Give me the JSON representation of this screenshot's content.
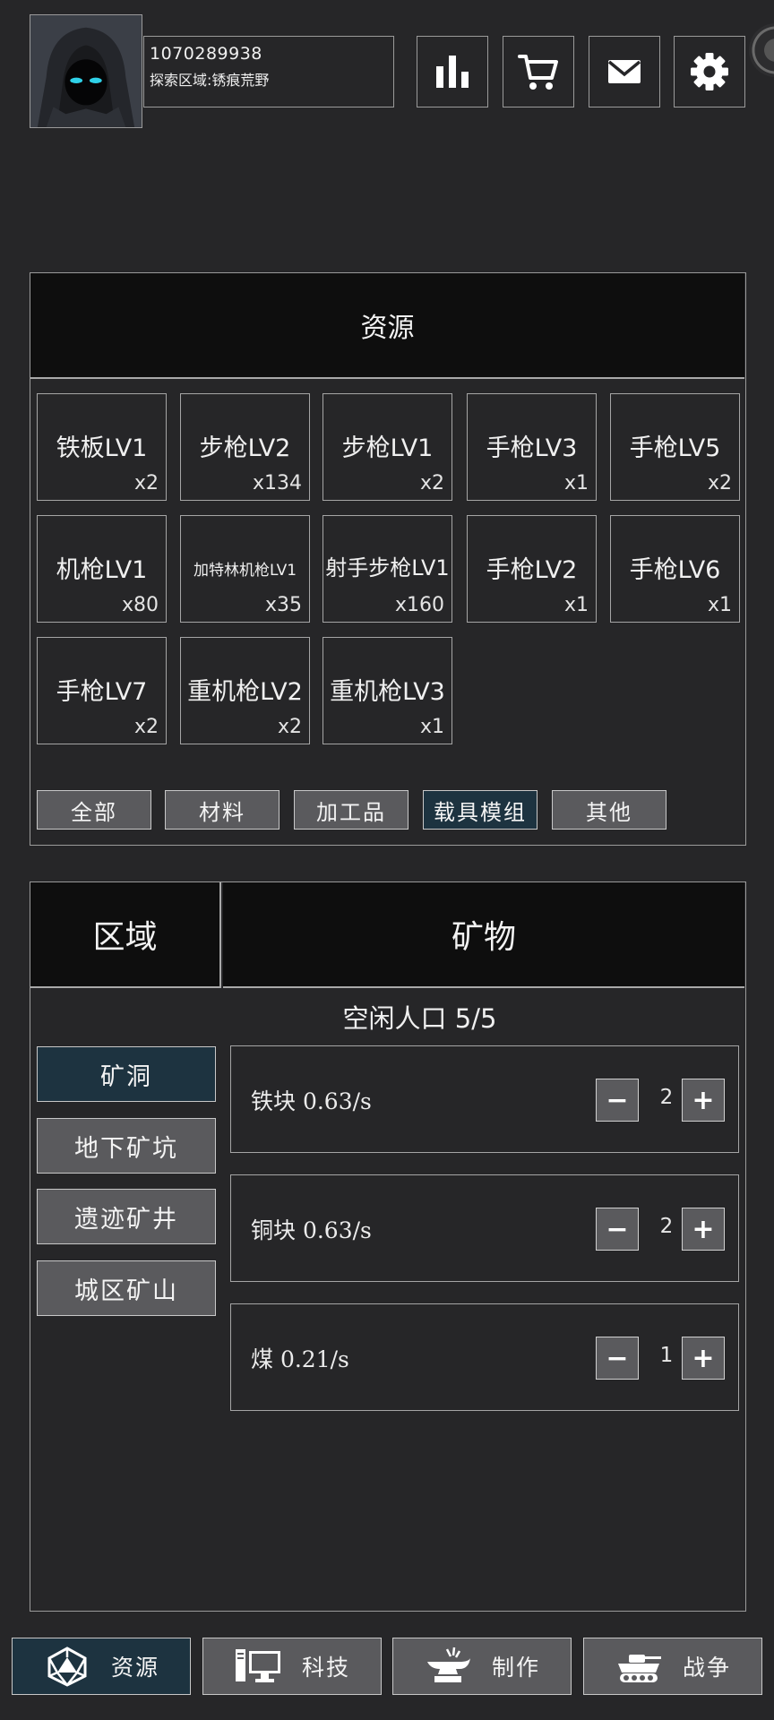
{
  "header": {
    "user_id": "1070289938",
    "explore_area": "探索区域:锈痕荒野",
    "buttons": [
      {
        "icon": "bar-chart-icon"
      },
      {
        "icon": "cart-icon"
      },
      {
        "icon": "mail-icon"
      },
      {
        "icon": "gear-icon"
      }
    ]
  },
  "resources": {
    "title": "资源",
    "items": [
      {
        "name": "铁板LV1",
        "qty": "x2"
      },
      {
        "name": "步枪LV2",
        "qty": "x134"
      },
      {
        "name": "步枪LV1",
        "qty": "x2"
      },
      {
        "name": "手枪LV3",
        "qty": "x1"
      },
      {
        "name": "手枪LV5",
        "qty": "x2"
      },
      {
        "name": "机枪LV1",
        "qty": "x80"
      },
      {
        "name": "加特林机枪LV1",
        "qty": "x35"
      },
      {
        "name": "射手步枪LV1",
        "qty": "x160"
      },
      {
        "name": "手枪LV2",
        "qty": "x1"
      },
      {
        "name": "手枪LV6",
        "qty": "x1"
      },
      {
        "name": "手枪LV7",
        "qty": "x2"
      },
      {
        "name": "重机枪LV2",
        "qty": "x2"
      },
      {
        "name": "重机枪LV3",
        "qty": "x1"
      }
    ],
    "filters": [
      {
        "label": "全部",
        "active": false
      },
      {
        "label": "材料",
        "active": false
      },
      {
        "label": "加工品",
        "active": false
      },
      {
        "label": "载具模组",
        "active": true
      },
      {
        "label": "其他",
        "active": false
      }
    ]
  },
  "area_panel": {
    "tab_area": "区域",
    "tab_minerals": "矿物",
    "idle_population": "空闲人口 5/5",
    "zones": [
      {
        "label": "矿洞",
        "active": true
      },
      {
        "label": "地下矿坑",
        "active": false
      },
      {
        "label": "遗迹矿井",
        "active": false
      },
      {
        "label": "城区矿山",
        "active": false
      }
    ],
    "minerals": [
      {
        "label": "铁块  0.63/s",
        "count": "2"
      },
      {
        "label": "铜块  0.63/s",
        "count": "2"
      },
      {
        "label": "煤  0.21/s",
        "count": "1"
      }
    ],
    "minus": "−",
    "plus": "+"
  },
  "bottom_nav": [
    {
      "label": "资源",
      "icon": "d20-dice-icon",
      "active": true
    },
    {
      "label": "科技",
      "icon": "computer-icon",
      "active": false
    },
    {
      "label": "制作",
      "icon": "anvil-icon",
      "active": false
    },
    {
      "label": "战争",
      "icon": "tank-icon",
      "active": false
    }
  ],
  "colors": {
    "background": "#262628",
    "panel_header": "#0e0e0e",
    "button": "#5a5a5d",
    "active": "#1d3340",
    "border": "#9a9a9a"
  }
}
